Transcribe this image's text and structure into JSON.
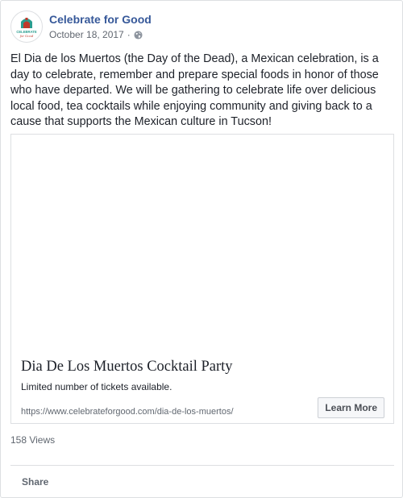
{
  "post": {
    "page_name": "Celebrate for Good",
    "date": "October 18, 2017",
    "separator": "·",
    "privacy_icon": "globe-icon",
    "message": "El Dia de los Muertos (the Day of the Dead), a Mexican celebration, is a day to celebrate, remember and prepare special foods in honor of those who have departed. We will be gathering to celebrate life over delicious local food, tea cocktails while enjoying community and giving back to a cause that supports the Mexican culture in Tucson!",
    "avatar": {
      "icon": "celebrate-for-good-logo",
      "logo_text_top": "CELEBRATE",
      "logo_text_bottom": "for Good"
    },
    "link": {
      "title": "Dia De Los Muertos Cocktail Party",
      "description": "Limited number of tickets available.",
      "url": "https://www.celebrateforgood.com/dia-de-los-muertos/",
      "cta_label": "Learn More"
    },
    "views": "158 Views",
    "actions": {
      "share_label": "Share"
    }
  },
  "colors": {
    "link_blue": "#365899",
    "meta_gray": "#616770",
    "border": "#dddfe2",
    "logo_teal": "#2a9d8f",
    "logo_red": "#c0392b"
  }
}
